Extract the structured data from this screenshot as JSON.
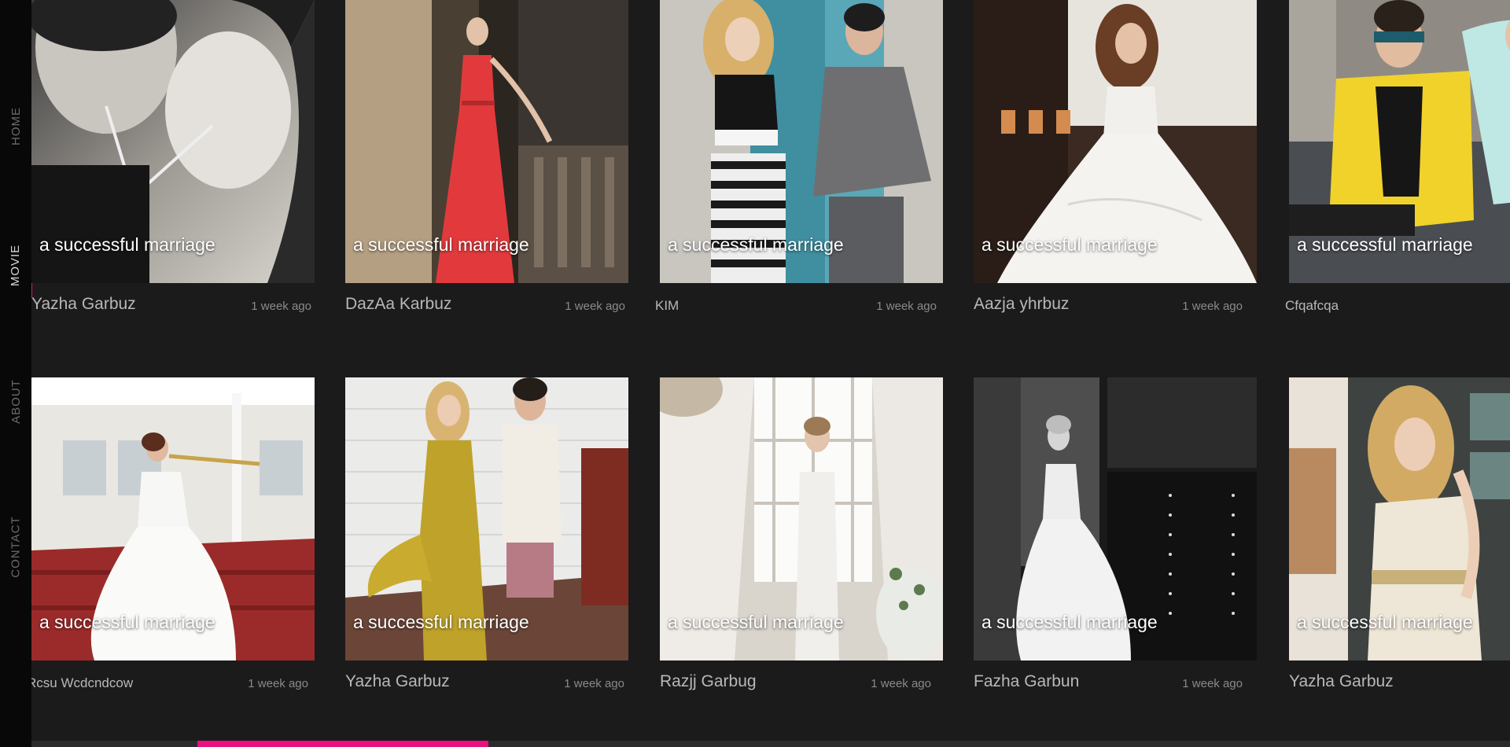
{
  "nav": {
    "items": [
      {
        "label": "HOME"
      },
      {
        "label": "MOVIE",
        "active": true
      },
      {
        "label": "ABOUT"
      },
      {
        "label": "CONTACT"
      }
    ]
  },
  "accent_color": "#e8117f",
  "gallery": {
    "row1": [
      {
        "caption": "a successful marriage",
        "name": "Yazha Garbuz",
        "time": "1 week ago"
      },
      {
        "caption": "a successful marriage",
        "name": "DazAa Karbuz",
        "time": "1 week ago"
      },
      {
        "caption": "a successful marriage",
        "name": "KIM",
        "time": "1 week ago"
      },
      {
        "caption": "a successful marriage",
        "name": "Aazja yhrbuz",
        "time": "1 week ago"
      },
      {
        "caption": "a successful marriage",
        "name": "Cfqafcqa",
        "time": ""
      }
    ],
    "row2": [
      {
        "caption": "a successful marriage",
        "name": "Rcsu  Wcdcndcow",
        "time": "1 week ago"
      },
      {
        "caption": "a successful marriage",
        "name": "Yazha Garbuz",
        "time": "1 week ago"
      },
      {
        "caption": "a successful marriage",
        "name": "Razjj Garbug",
        "time": "1 week ago"
      },
      {
        "caption": "a successful marriage",
        "name": "Fazha Garbun",
        "time": "1 week ago"
      },
      {
        "caption": "a successful marriage",
        "name": "Yazha Garbuz",
        "time": ""
      }
    ]
  }
}
